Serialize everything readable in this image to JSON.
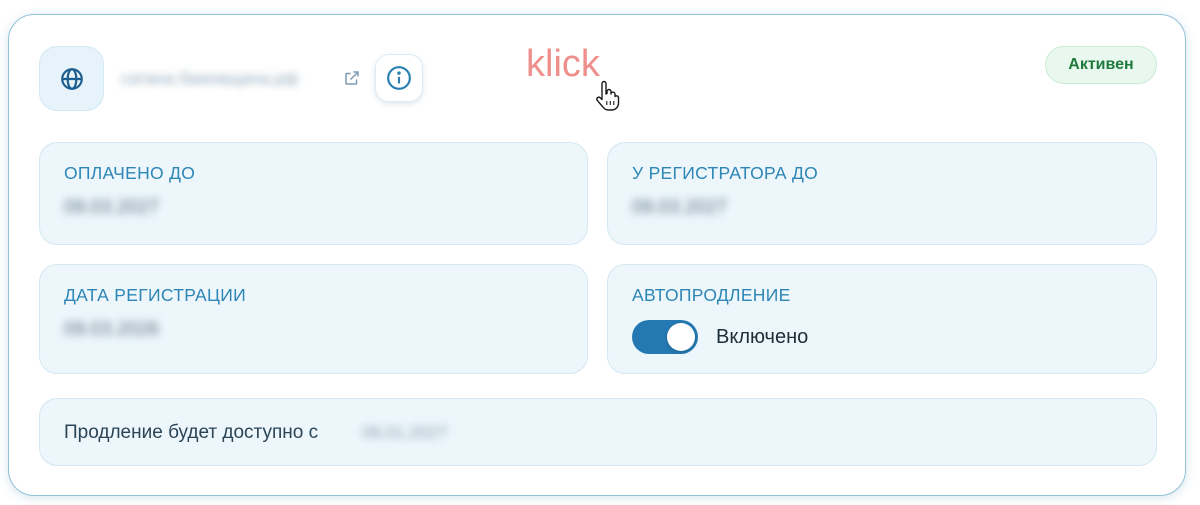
{
  "header": {
    "domain_name": "сатана.бажовщина.рф",
    "status_badge": "Активен",
    "icons": {
      "globe": "globe-icon",
      "external_link": "external-link-icon",
      "info": "info-icon"
    }
  },
  "fields": {
    "paid_until": {
      "label": "ОПЛАЧЕНО ДО",
      "value": "09.03.2027"
    },
    "registrar_until": {
      "label": "У РЕГИСТРАТОРА ДО",
      "value": "09.03.2027"
    },
    "registration_date": {
      "label": "ДАТА РЕГИСТРАЦИИ",
      "value": "09.03.2026"
    },
    "autorenew": {
      "label": "АВТОПРОДЛЕНИЕ",
      "state_label": "Включено",
      "enabled": true
    }
  },
  "renewal": {
    "text": "Продление будет доступно с",
    "date": "08.01.2027"
  },
  "annotation": {
    "text": "klick",
    "cursor_icon": "hand-pointer-icon"
  },
  "colors": {
    "accent": "#2579b3",
    "label": "#2d86b5",
    "panel_bg": "#ecf6fb",
    "badge_bg": "#e9f8ee",
    "badge_text": "#1f7a3d",
    "annotation": "#ef8f8c"
  }
}
